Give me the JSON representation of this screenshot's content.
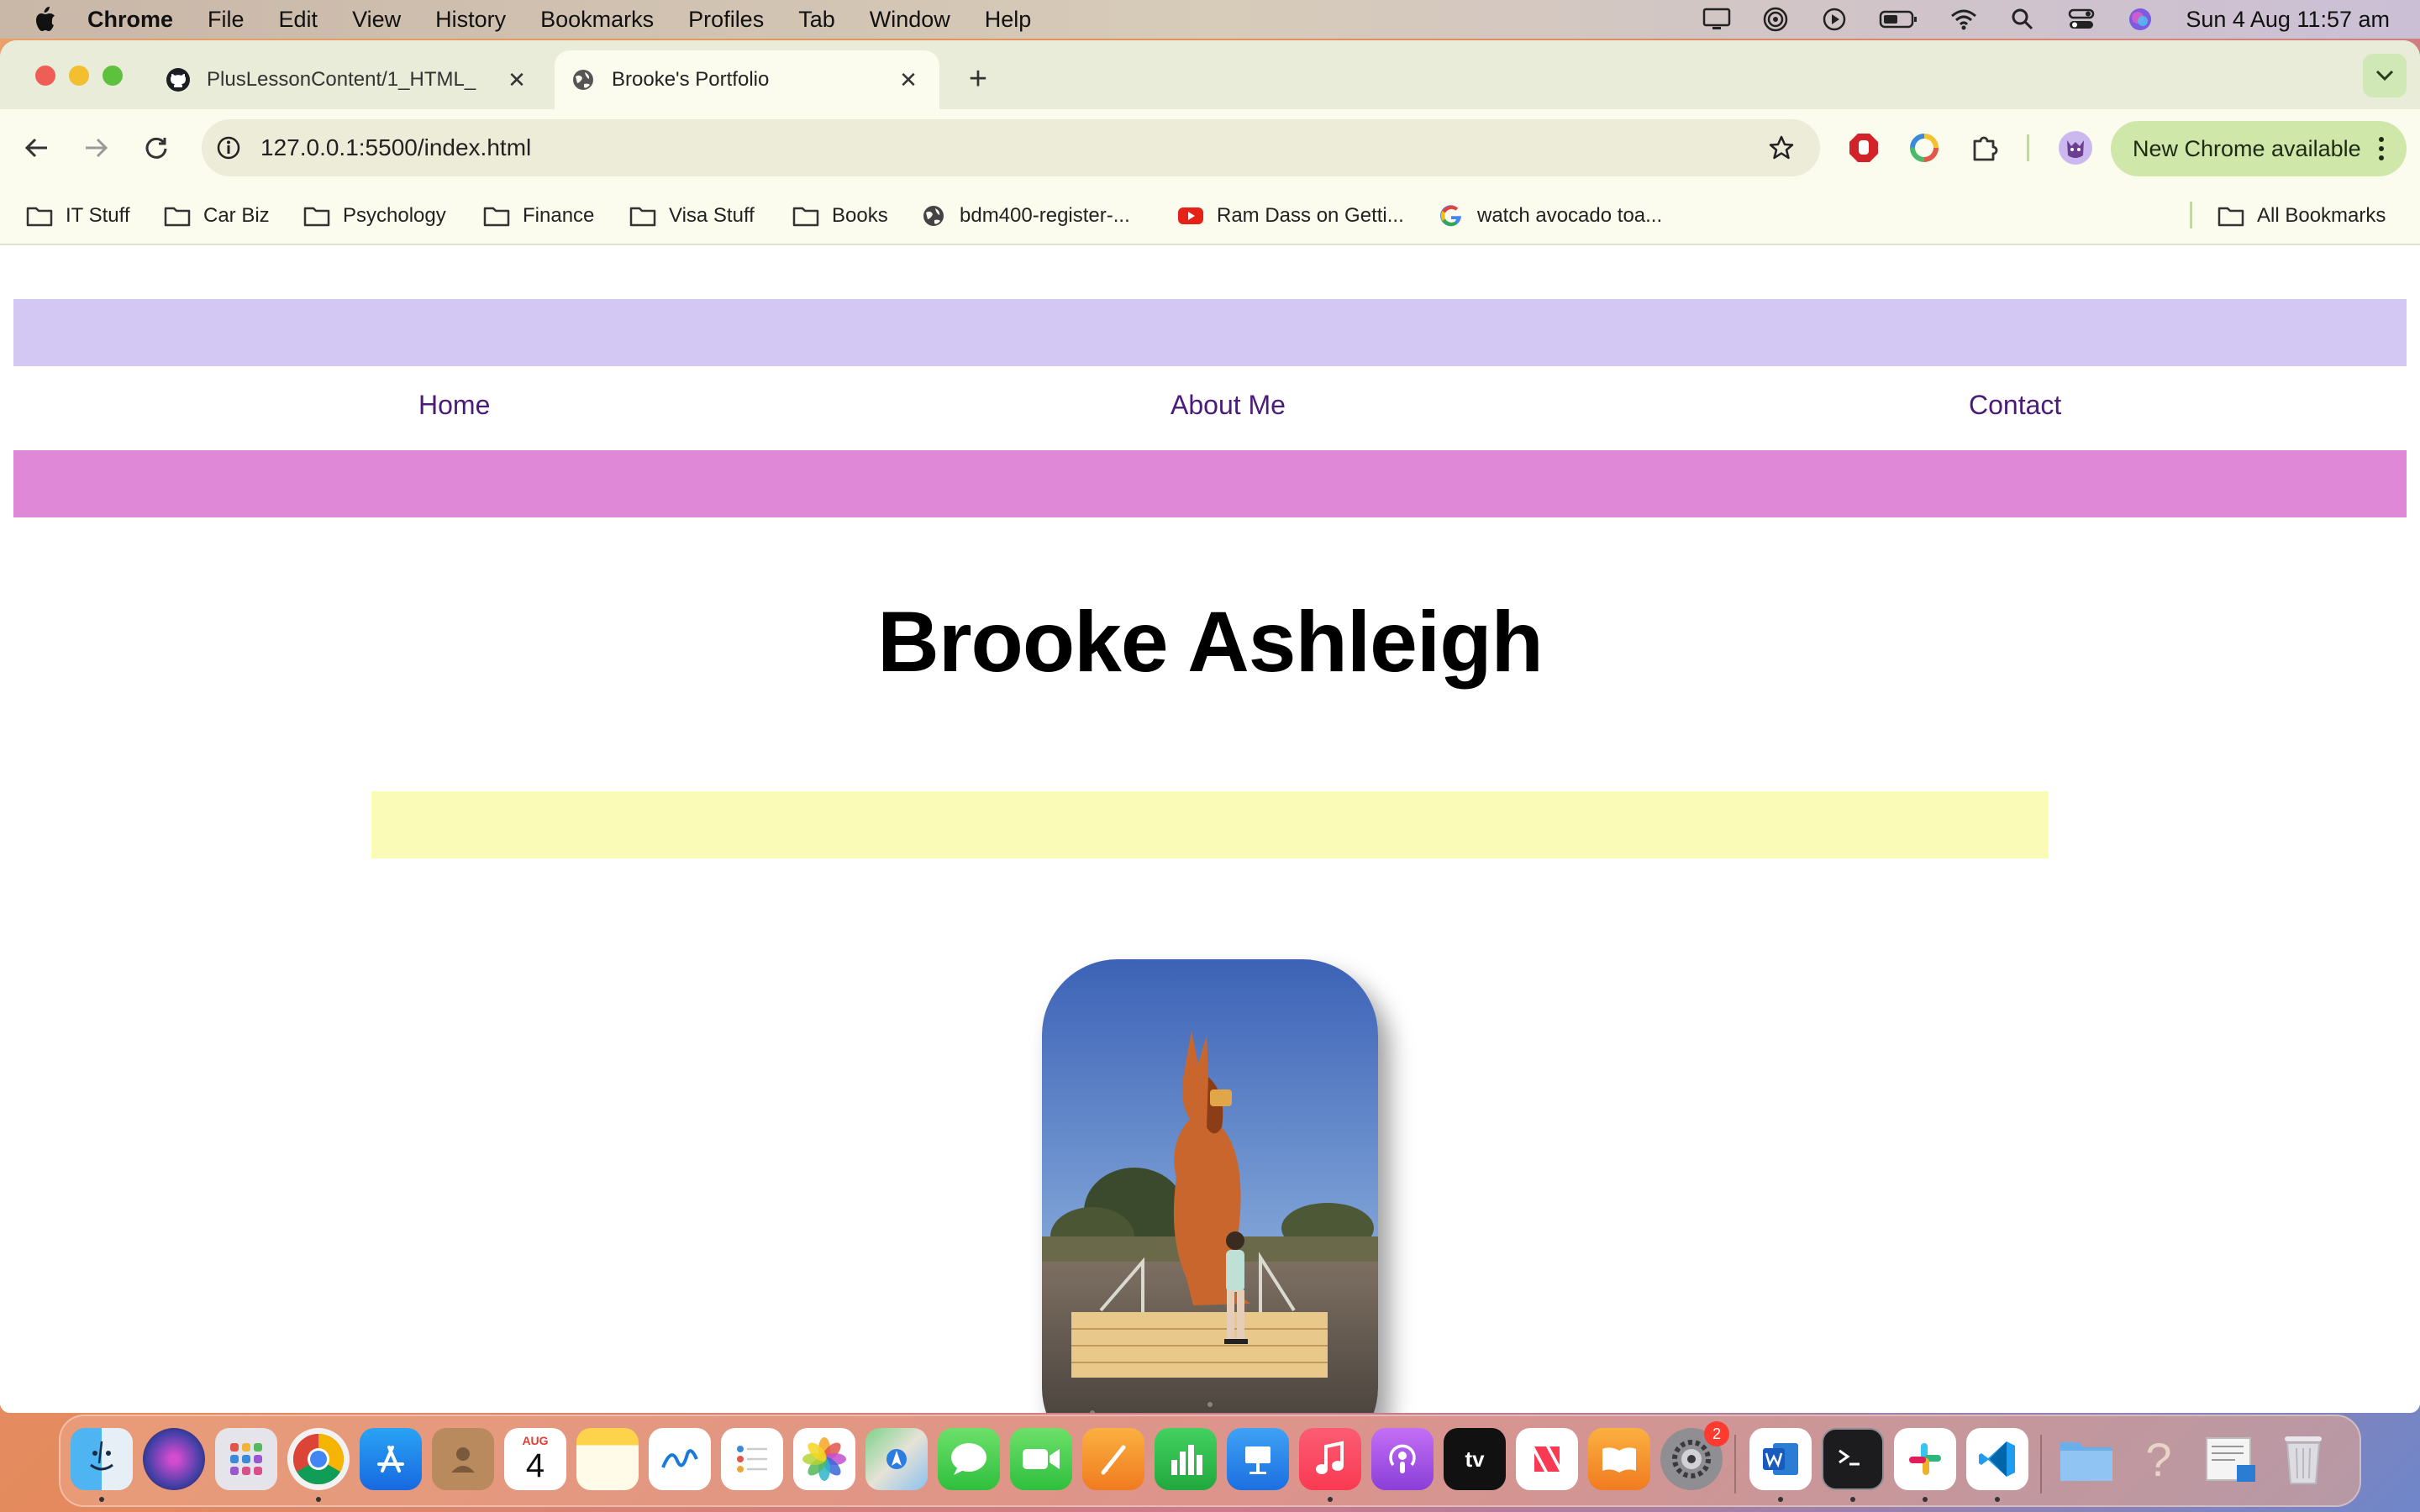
{
  "menubar": {
    "app_name": "Chrome",
    "items": [
      "File",
      "Edit",
      "View",
      "History",
      "Bookmarks",
      "Profiles",
      "Tab",
      "Window",
      "Help"
    ],
    "clock": "Sun 4 Aug  11:57 am"
  },
  "tabs": [
    {
      "title": "PlusLessonContent/1_HTML_",
      "icon": "github-icon"
    },
    {
      "title": "Brooke's Portfolio",
      "icon": "globe-icon",
      "active": true
    }
  ],
  "toolbar": {
    "url": "127.0.0.1:5500/index.html",
    "update_label": "New Chrome available"
  },
  "bookmarks": [
    {
      "label": "IT Stuff",
      "icon": "folder-icon"
    },
    {
      "label": "Car Biz",
      "icon": "folder-icon"
    },
    {
      "label": "Psychology",
      "icon": "folder-icon"
    },
    {
      "label": "Finance",
      "icon": "folder-icon"
    },
    {
      "label": "Visa Stuff",
      "icon": "folder-icon"
    },
    {
      "label": "Books",
      "icon": "folder-icon"
    },
    {
      "label": "bdm400-register-...",
      "icon": "globe-icon"
    },
    {
      "label": "Ram Dass on Getti...",
      "icon": "youtube-icon"
    },
    {
      "label": "watch avocado toa...",
      "icon": "google-icon"
    }
  ],
  "all_bookmarks": "All Bookmarks",
  "page": {
    "nav": {
      "home": "Home",
      "about": "About Me",
      "contact": "Contact"
    },
    "title": "Brooke Ashleigh",
    "colors": {
      "band_top": "#d3c8f4",
      "band_mid": "#de88d7",
      "band_yellow": "#fbfbb8",
      "nav_link": "#4b1b7a"
    }
  },
  "dock": {
    "calendar_month": "AUG",
    "calendar_day": "4",
    "settings_badge": "2",
    "apps": [
      "finder-icon",
      "siri-icon",
      "launchpad-icon",
      "chrome-icon",
      "app-store-icon",
      "contacts-icon",
      "calendar-icon",
      "notes-icon",
      "freeform-icon",
      "reminders-icon",
      "photos-icon",
      "maps-icon",
      "messages-icon",
      "facetime-icon",
      "pages-icon",
      "numbers-icon",
      "keynote-icon",
      "music-icon",
      "podcasts-icon",
      "apple-tv-icon",
      "news-icon",
      "books-icon",
      "system-settings-icon",
      "word-icon",
      "terminal-icon",
      "slack-icon",
      "vscode-icon",
      "downloads-folder-icon",
      "help-icon",
      "preview-icon",
      "trash-icon"
    ]
  }
}
